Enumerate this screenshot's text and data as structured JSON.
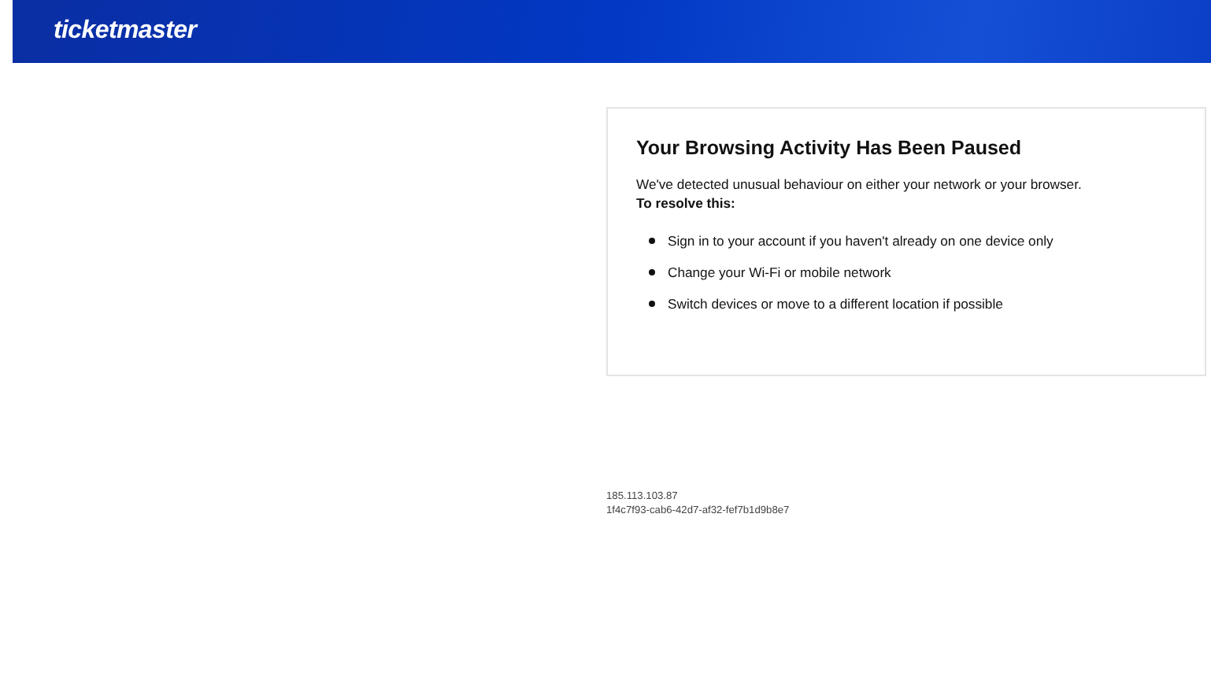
{
  "header": {
    "logo": "ticketmaster"
  },
  "notice": {
    "title": "Your Browsing Activity Has Been Paused",
    "message": "We've detected unusual behaviour on either your network or your browser.",
    "resolve_label": "To resolve this:",
    "steps": [
      "Sign in to your account if you haven't already on one device only",
      "Change your Wi-Fi or mobile network",
      "Switch devices or move to a different location if possible"
    ]
  },
  "footer": {
    "ip": "185.113.103.87",
    "request_id": "1f4c7f93-cab6-42d7-af32-fef7b1d9b8e7"
  }
}
